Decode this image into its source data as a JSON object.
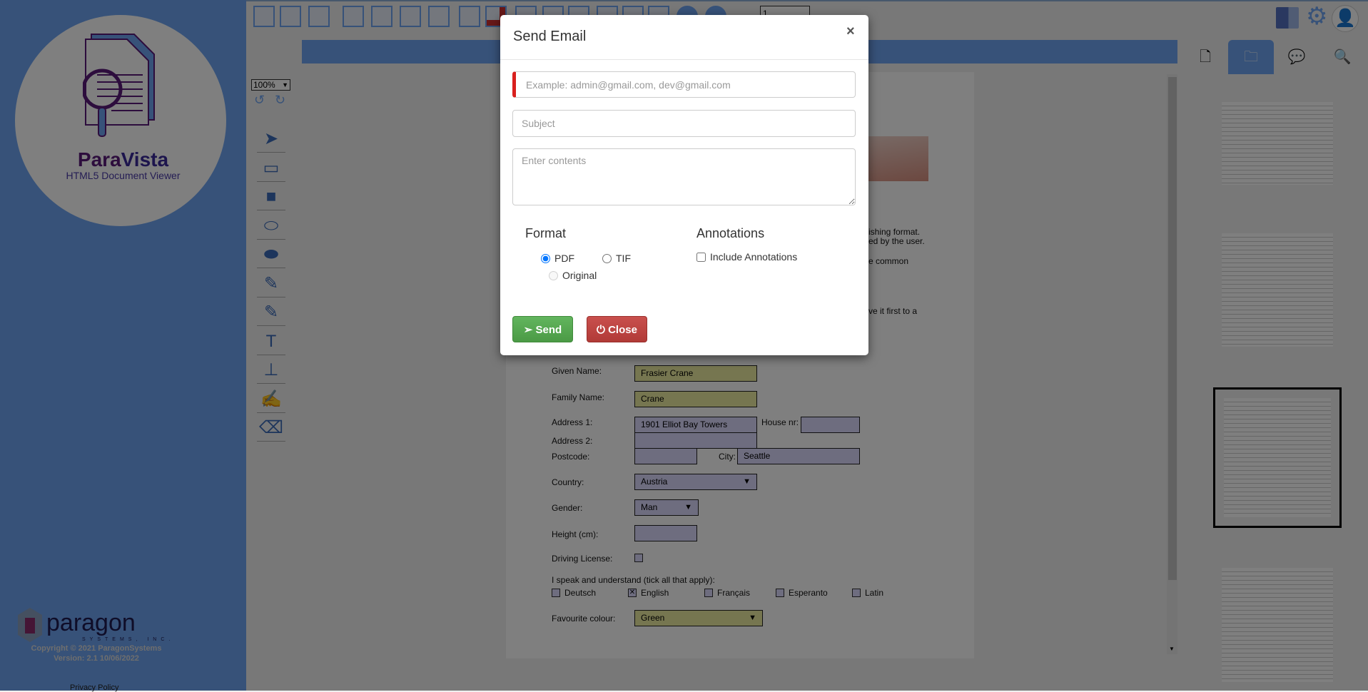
{
  "sidebar": {
    "app_name_part1": "Para",
    "app_name_part2": "Vista",
    "subtitle": "HTML5 Document Viewer",
    "company_logo": "paragon SYSTEMS, INC.",
    "copyright": "Copyright © 2021 ParagonSystems",
    "version": "Version: 2.1 10/06/2022",
    "privacy": "Privacy Policy"
  },
  "toolbar": {
    "icons": [
      "fit-icon",
      "crop-icon",
      "search-document-icon",
      "save-icon",
      "save-as-icon",
      "copy-icon",
      "add-document-icon",
      "export-icon",
      "delete-document-icon",
      "page-icon",
      "print-icon",
      "download-icon",
      "ocr-icon",
      "line-icon",
      "pen-icon",
      "circle-icon",
      "circle-icon"
    ],
    "page_value": "1",
    "right_icons": [
      "panel-toggle-icon",
      "gear-icon",
      "avatar-icon"
    ]
  },
  "tools": {
    "zoom": "100%",
    "items": [
      "pointer",
      "rectangle",
      "filled-rectangle",
      "ellipse",
      "filled-ellipse",
      "highlighter",
      "marker",
      "text",
      "stamp",
      "signature",
      "eraser"
    ]
  },
  "document": {
    "fragments": [
      "ishing format.",
      "ed by the user.",
      "e common",
      "ve it first to a"
    ],
    "form": {
      "given_name_label": "Given Name:",
      "given_name": "Frasier Crane",
      "family_name_label": "Family Name:",
      "family_name": "Crane",
      "address1_label": "Address 1:",
      "address1": "1901 Elliot Bay Towers",
      "house_label": "House nr:",
      "address2_label": "Address 2:",
      "postcode_label": "Postcode:",
      "city_label": "City:",
      "city": "Seattle",
      "country_label": "Country:",
      "country": "Austria",
      "gender_label": "Gender:",
      "gender": "Man",
      "height_label": "Height (cm):",
      "license_label": "Driving License:",
      "languages_label": "I speak and understand (tick all that apply):",
      "languages": [
        {
          "name": "Deutsch",
          "checked": false
        },
        {
          "name": "English",
          "checked": true
        },
        {
          "name": "Français",
          "checked": false
        },
        {
          "name": "Esperanto",
          "checked": false
        },
        {
          "name": "Latin",
          "checked": false
        }
      ],
      "colour_label": "Favourite colour:",
      "colour": "Green"
    }
  },
  "right_panel": {
    "tabs": [
      "page-icon",
      "folder-icon",
      "comments-icon",
      "search-icon"
    ],
    "active_tab": 1,
    "selected_thumbnail": 2
  },
  "modal": {
    "title": "Send Email",
    "close": "×",
    "email_placeholder": "Example: admin@gmail.com, dev@gmail.com",
    "subject_placeholder": "Subject",
    "contents_placeholder": "Enter contents",
    "format_heading": "Format",
    "format_options": [
      "PDF",
      "TIF",
      "Original"
    ],
    "format_selected": "PDF",
    "annotations_heading": "Annotations",
    "include_annotations": "Include Annotations",
    "send": "Send",
    "close_button": "Close",
    "colors": {
      "send": "#5cb85c",
      "close": "#c9302c",
      "required": "#d9201e"
    }
  }
}
